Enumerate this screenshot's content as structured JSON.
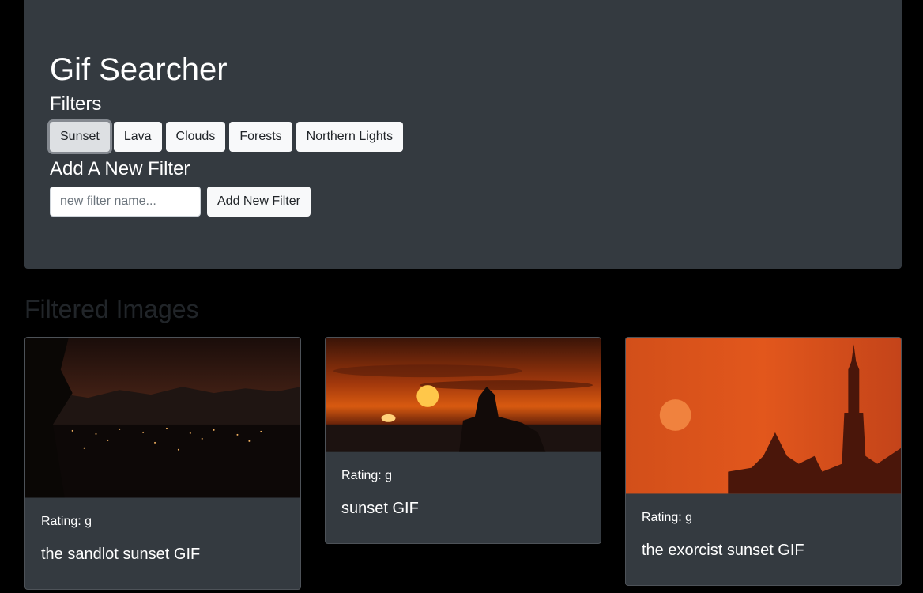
{
  "header": {
    "title": "Gif Searcher",
    "filters_title": "Filters",
    "filters": [
      {
        "label": "Sunset",
        "active": true
      },
      {
        "label": "Lava",
        "active": false
      },
      {
        "label": "Clouds",
        "active": false
      },
      {
        "label": "Forests",
        "active": false
      },
      {
        "label": "Northern Lights",
        "active": false
      }
    ],
    "add_filter_title": "Add A New Filter",
    "add_filter_placeholder": "new filter name...",
    "add_filter_button": "Add New Filter"
  },
  "images_section": {
    "title": "Filtered Images",
    "cards": [
      {
        "rating": "Rating: g",
        "title": "the sandlot sunset GIF"
      },
      {
        "rating": "Rating: g",
        "title": "sunset GIF"
      },
      {
        "rating": "Rating: g",
        "title": "the exorcist sunset GIF"
      }
    ]
  },
  "colors": {
    "page_background": "#000000",
    "panel_background": "#343a40",
    "button_background": "#f8f9fa",
    "muted_title": "#212529"
  }
}
